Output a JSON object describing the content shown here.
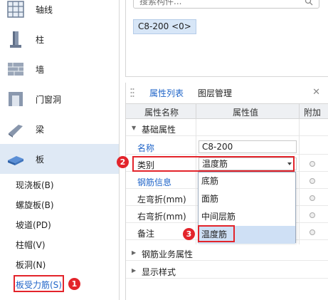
{
  "nav": {
    "categories": [
      {
        "label": "轴线",
        "icon": "grid-icon"
      },
      {
        "label": "柱",
        "icon": "column-icon"
      },
      {
        "label": "墙",
        "icon": "wall-icon"
      },
      {
        "label": "门窗洞",
        "icon": "door-window-icon"
      },
      {
        "label": "梁",
        "icon": "beam-icon"
      },
      {
        "label": "板",
        "icon": "slab-icon"
      }
    ],
    "sub_items": [
      {
        "label": "现浇板(B)"
      },
      {
        "label": "螺旋板(B)"
      },
      {
        "label": "坡道(PD)"
      },
      {
        "label": "柱帽(V)"
      },
      {
        "label": "板洞(N)"
      },
      {
        "label": "板受力筋(S)"
      }
    ]
  },
  "search": {
    "placeholder": "搜索构件..."
  },
  "component_chip": "C8-200 <0>",
  "panel": {
    "tabs": [
      "属性列表",
      "图层管理"
    ],
    "headers": {
      "name": "属性名称",
      "value": "属性值",
      "extra": "附加"
    },
    "groups": {
      "basic": "基础属性",
      "rebar_business": "钢筋业务属性",
      "display_style": "显示样式"
    },
    "rows": [
      {
        "name": "名称",
        "value": "C8-200"
      },
      {
        "name": "类别",
        "value": "温度筋"
      },
      {
        "name": "钢筋信息",
        "value": ""
      },
      {
        "name": "左弯折(mm)",
        "value": ""
      },
      {
        "name": "右弯折(mm)",
        "value": ""
      },
      {
        "name": "备注",
        "value": ""
      }
    ]
  },
  "dropdown": {
    "options": [
      "底筋",
      "面筋",
      "中间层筋",
      "温度筋"
    ],
    "selected": "温度筋"
  },
  "annotations": [
    "1",
    "2",
    "3"
  ],
  "colors": {
    "accent": "#1f64c8",
    "annotation": "#e3242b",
    "selected_bg": "#dfe9f5"
  }
}
